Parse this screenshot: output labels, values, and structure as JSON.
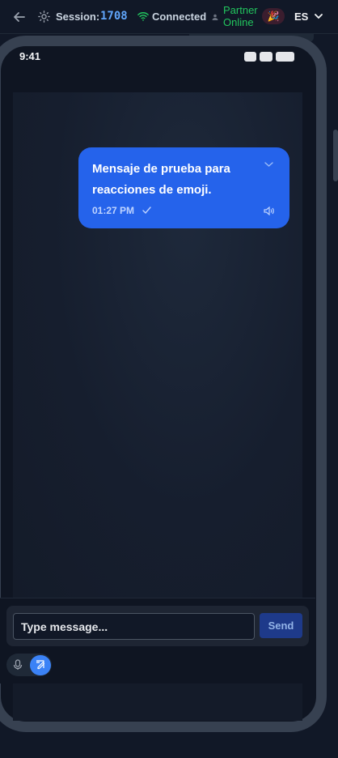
{
  "header": {
    "session_label": "Session:",
    "session_id": "1708",
    "connection_status": "Connected",
    "partner_status": "Partner Online",
    "party_emoji": "🎉",
    "language": "ES"
  },
  "status_bar": {
    "time": "9:41"
  },
  "messages": [
    {
      "text": "Mensaje de prueba para reacciones de emoji.",
      "time": "01:27 PM",
      "status_icon": "check-icon",
      "audio_icon": "speaker-icon"
    }
  ],
  "composer": {
    "placeholder": "Type message...",
    "send_label": "Send"
  },
  "colors": {
    "accent": "#2563eb",
    "online": "#22c55e",
    "session_id": "#60a5fa"
  }
}
